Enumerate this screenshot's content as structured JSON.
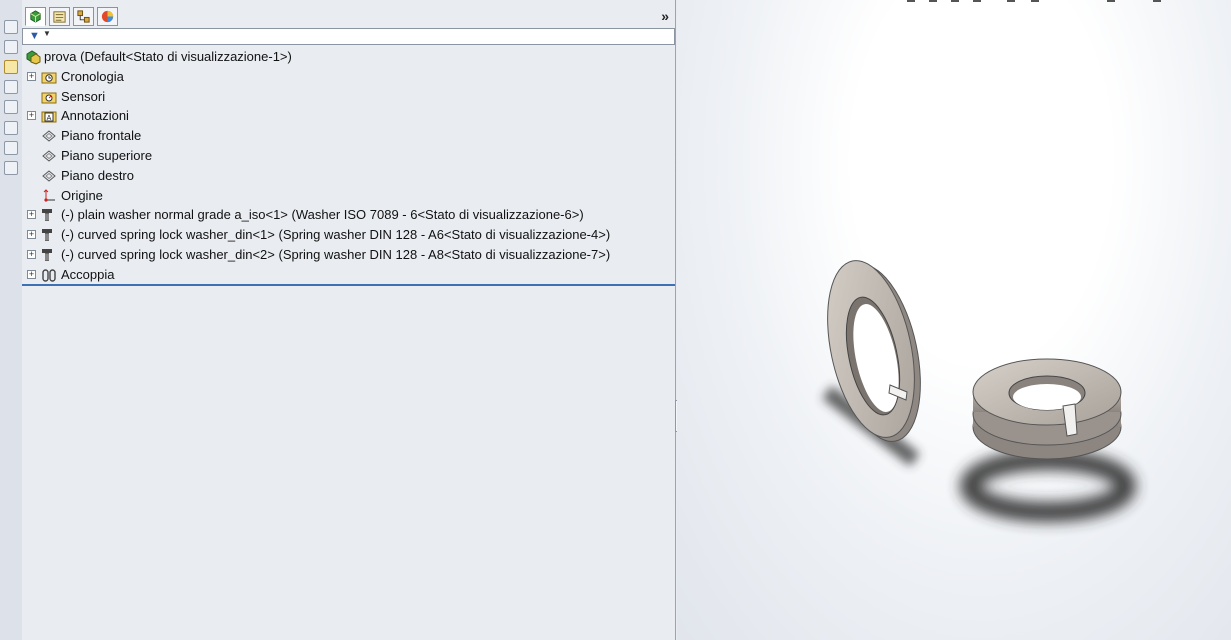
{
  "feature_manager": {
    "tabs": [
      {
        "icon": "feature-tree-icon",
        "active": true
      },
      {
        "icon": "property-manager-icon",
        "active": false
      },
      {
        "icon": "configuration-manager-icon",
        "active": false
      },
      {
        "icon": "display-manager-icon",
        "active": false
      }
    ],
    "more_label": "»",
    "filter_icon": "filter-icon",
    "tree": [
      {
        "label": "prova  (Default<Stato di visualizzazione-1>)",
        "icon": "assembly-icon",
        "expander": false,
        "level": 0
      },
      {
        "label": "Cronologia",
        "icon": "history-folder-icon",
        "expander": true,
        "level": 1
      },
      {
        "label": "Sensori",
        "icon": "sensor-folder-icon",
        "expander": false,
        "level": 1
      },
      {
        "label": "Annotazioni",
        "icon": "annotation-folder-icon",
        "expander": true,
        "level": 1
      },
      {
        "label": "Piano frontale",
        "icon": "plane-icon",
        "expander": false,
        "level": 1
      },
      {
        "label": "Piano superiore",
        "icon": "plane-icon",
        "expander": false,
        "level": 1
      },
      {
        "label": "Piano destro",
        "icon": "plane-icon",
        "expander": false,
        "level": 1
      },
      {
        "label": "Origine",
        "icon": "origin-icon",
        "expander": false,
        "level": 1
      },
      {
        "label": "(-) plain washer normal grade a_iso<1> (Washer ISO 7089 - 6<Stato di visualizzazione-6>)",
        "icon": "toolbox-part-icon",
        "expander": true,
        "level": 1
      },
      {
        "label": "(-) curved spring lock washer_din<1> (Spring washer DIN 128 - A6<Stato di visualizzazione-4>)",
        "icon": "toolbox-part-icon",
        "expander": true,
        "level": 1
      },
      {
        "label": "(-) curved spring lock washer_din<2> (Spring washer DIN 128 - A8<Stato di visualizzazione-7>)",
        "icon": "toolbox-part-icon",
        "expander": true,
        "level": 1
      },
      {
        "label": "Accoppia",
        "icon": "mates-icon",
        "expander": true,
        "level": 1
      }
    ]
  },
  "colors": {
    "panel_bg": "#e9edf2",
    "accent_line": "#3f6fb5",
    "washer_face": "#c9c2bb",
    "washer_edge": "#7f7873",
    "shadow": "#3a3a3a"
  }
}
